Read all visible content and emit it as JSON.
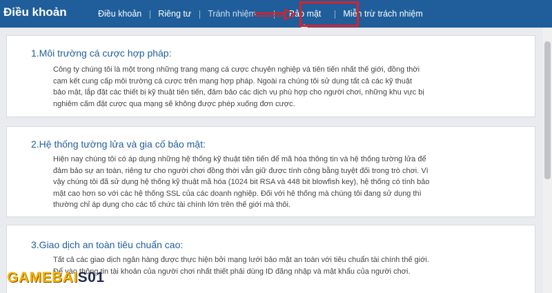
{
  "header": {
    "title": "Điều khoản",
    "tabs": [
      {
        "label": "Điều khoản"
      },
      {
        "label": "Riêng tư"
      },
      {
        "label": "Tránh nhiệm ..."
      },
      {
        "label": "Bảo mật"
      },
      {
        "label": "Miễn trừ trách nhiệm"
      }
    ],
    "active_tab": "Bảo mật",
    "highlight_color": "#e01f26"
  },
  "sections": [
    {
      "title": "1.Môi trường cá cược hợp pháp:",
      "lines": [
        "Công ty chúng tôi là một trong những trang mạng cá cược chuyên nghiệp và tiên tiến nhất thế giới, đồng thời",
        "cam kết cung cấp môi trường cá cược trên mạng hợp pháp. Ngoài ra chúng tôi sử dụng tất cả các kỹ thuật",
        "bảo mật, lắp đặt các thiết bị kỹ thuật tiên tiến, đảm bảo các dịch vụ phù hợp cho người chơi, những khu vực bị",
        "nghiêm cấm đặt cược qua mạng sẽ không được phép xuống đơn cược."
      ]
    },
    {
      "title": "2.Hệ thống tường lửa và gia cố bảo mật:",
      "lines": [
        "Hiện nay chúng tôi có áp dụng những hệ thống kỹ thuật tiên tiến để mã hóa thông tin và hệ thống tường lửa để",
        "đảm bảo sự an toàn, riêng tư cho người chơi đồng thời vẫn giữ được tính công bằng tuyệt đối trong trò chơi. Vì",
        "vậy chúng tôi đã sử dụng hệ thống kỹ thuật mã hóa (1024 bit RSA và 448 bit blowfish key), hệ thống có tính bảo",
        "mật cao hơn so với các hệ thống SSL của các doanh nghiệp. Đối với hệ thống mà chúng tôi đang sử dụng thì",
        "thường chỉ áp dụng cho các tổ chức tài chính lớn trên thế giới mà thôi."
      ]
    },
    {
      "title": "3.Giao dịch an toàn tiêu chuẩn cao:",
      "lines": [
        "Tất cả các giao dịch ngân hàng được thực hiện bởi mạng lưới bảo mật an toàn với tiêu chuẩn tài chính thế giới.",
        "Để vào thông tin tài khoản của người chơi nhất thiết phải dùng ID đăng nhập và mật khẩu của người chơi."
      ]
    }
  ],
  "watermark": {
    "part1": "GAMEBAI",
    "part2": "S01"
  }
}
